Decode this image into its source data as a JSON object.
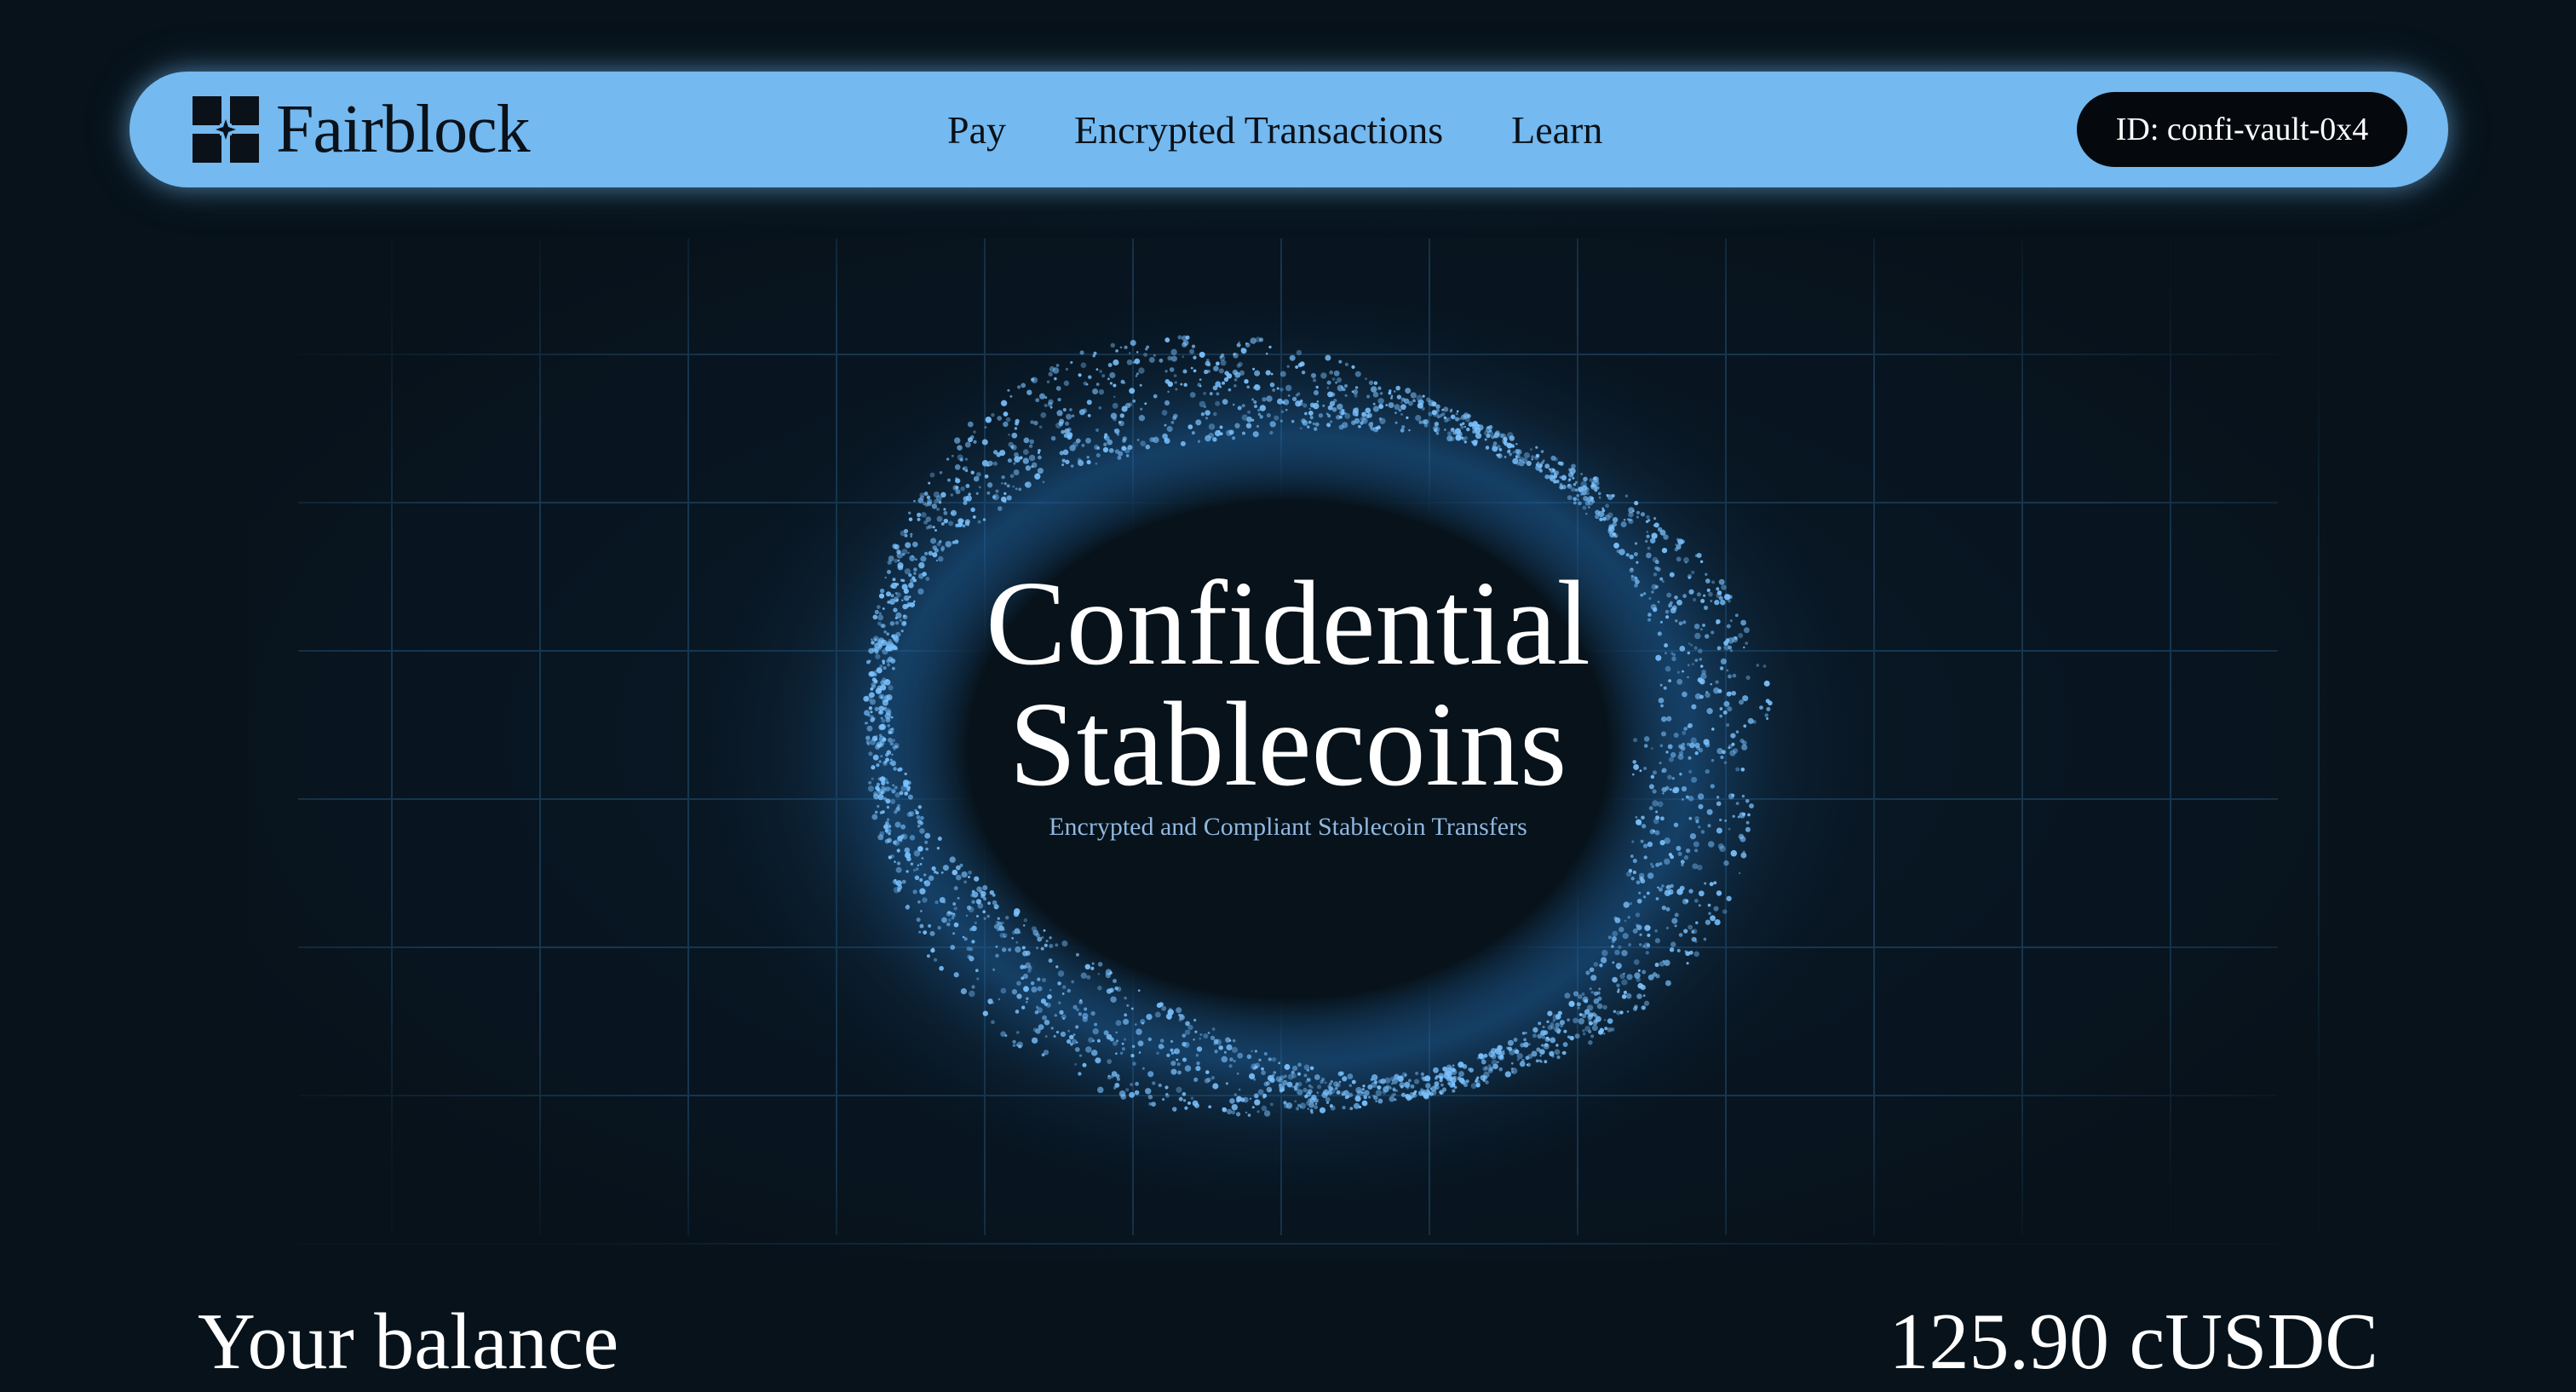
{
  "brand": {
    "name": "Fairblock",
    "logo_icon": "fairblock-logo-icon"
  },
  "nav": {
    "items": [
      {
        "label": "Pay"
      },
      {
        "label": "Encrypted Transactions"
      },
      {
        "label": "Learn"
      }
    ],
    "account_id": "ID: confi-vault-0x4"
  },
  "hero": {
    "title_line1": "Confidential",
    "title_line2": "Stablecoins",
    "subtitle": "Encrypted and Compliant Stablecoin Transfers"
  },
  "balance": {
    "label": "Your balance",
    "value": "125.90 cUSDC"
  },
  "colors": {
    "background": "#07121a",
    "navbar": "#74b9f0",
    "pill": "#05090d",
    "particle": "#7cc3ff",
    "subtitle": "#8fb8e0"
  }
}
